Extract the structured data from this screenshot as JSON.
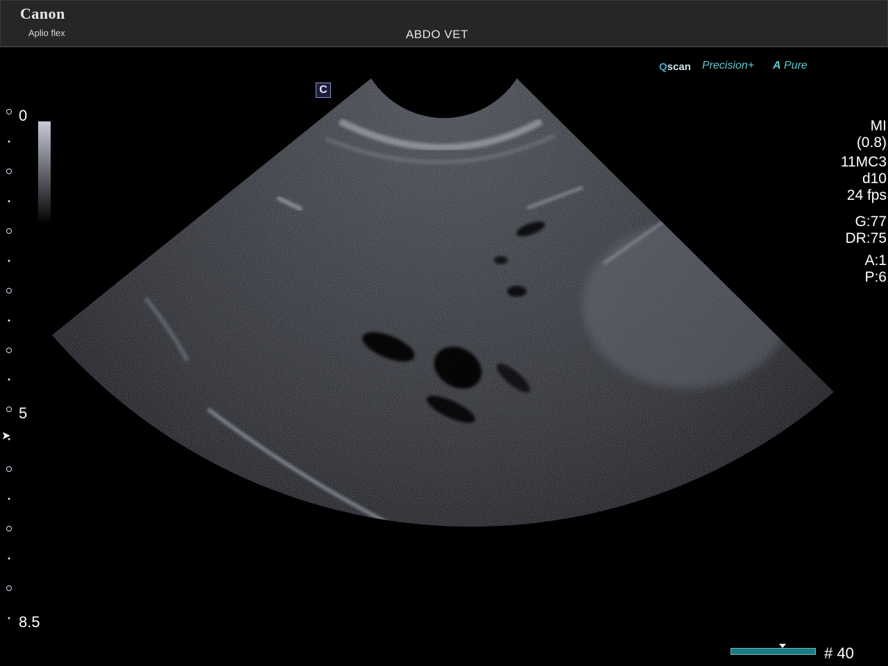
{
  "header": {
    "brand": "Canon",
    "model": "Aplio flex",
    "preset": "ABDO VET"
  },
  "mode_flags": {
    "qscan_q": "Q",
    "qscan_rest": "scan",
    "precision": "Precision+",
    "apure_a": "A",
    "apure_rest": "Pure"
  },
  "orientation_marker": "C",
  "depth_scale": {
    "top": "0",
    "mid": "5",
    "bottom": "8.5",
    "max_cm": 8.5,
    "focus_depth_cm": 5.4
  },
  "params": {
    "mi_label": "MI",
    "mi_value": "(0.8)",
    "probe": "11MC3",
    "depth": "d10",
    "frame_rate": "24 fps",
    "gain": "G:77",
    "dynamic_range": "DR:75",
    "a": "A:1",
    "p": "P:6"
  },
  "cine": {
    "frame_label": "# 40",
    "position_fraction": 0.62
  },
  "colors": {
    "header_bg": "#262626",
    "accent_teal": "#5fc7ce",
    "cine_bar": "#1a7c83",
    "marker": "#dfe4ff"
  }
}
